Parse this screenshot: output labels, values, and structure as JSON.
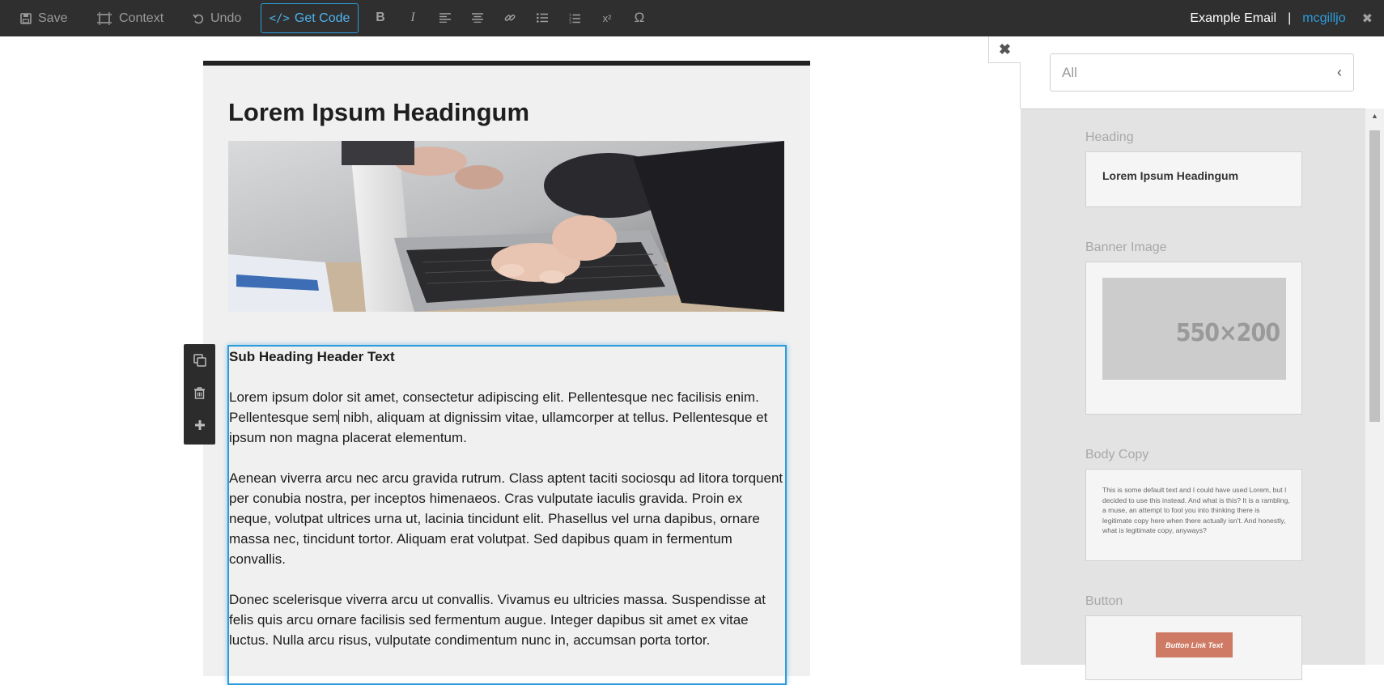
{
  "toolbar": {
    "save_label": "Save",
    "context_label": "Context",
    "undo_label": "Undo",
    "get_code_label": "Get Code",
    "get_code_icon": "</>",
    "format_buttons": [
      {
        "name": "bold",
        "glyph": "B"
      },
      {
        "name": "italic",
        "glyph": "I"
      },
      {
        "name": "align-left",
        "glyph": "align-left"
      },
      {
        "name": "align-center",
        "glyph": "align-center"
      },
      {
        "name": "link",
        "glyph": "link"
      },
      {
        "name": "bullet-list",
        "glyph": "bullet-list"
      },
      {
        "name": "numbered-list",
        "glyph": "numbered-list"
      },
      {
        "name": "superscript",
        "glyph": "x²"
      },
      {
        "name": "special-char",
        "glyph": "Ω"
      }
    ],
    "document_title": "Example Email",
    "separator": "|",
    "username": "mcgilljo",
    "close_glyph": "✖"
  },
  "email": {
    "heading": "Lorem Ipsum Headingum",
    "sub_heading": "Sub Heading Header Text",
    "paragraph_1_before_caret": "Lorem ipsum dolor sit amet, consectetur adipiscing elit. Pellentesque nec facilisis enim. Pellentesque sem",
    "paragraph_1_after_caret": "nibh, aliquam at dignissim vitae, ullamcorper at tellus. Pellentesque et ipsum non magna placerat elementum.",
    "paragraph_2": "Aenean viverra arcu nec arcu gravida rutrum. Class aptent taciti sociosqu ad litora torquent per conubia nostra, per inceptos himenaeos. Cras vulputate iaculis gravida. Proin ex neque, volutpat ultrices urna ut, lacinia tincidunt elit. Phasellus vel urna dapibus, ornare massa nec, tincidunt tortor. Aliquam erat volutpat. Sed dapibus quam in fermentum convallis.",
    "paragraph_3": "Donec scelerisque viverra arcu ut convallis. Vivamus eu ultricies massa. Suspendisse at felis quis arcu ornare facilisis sed fermentum augue. Integer dapibus sit amet ex vitae luctus. Nulla arcu risus, vulputate condimentum nunc in, accumsan porta tortor."
  },
  "block_tools": [
    "copy-icon",
    "trash-icon",
    "plus-icon"
  ],
  "panel": {
    "close_glyph": "✖",
    "filter_value": "All",
    "filter_chevron": "‹",
    "categories": {
      "heading": {
        "label": "Heading",
        "preview_text": "Lorem Ipsum Headingum"
      },
      "banner": {
        "label": "Banner Image",
        "placeholder_text": "550×200"
      },
      "body": {
        "label": "Body Copy",
        "preview_text": "This is some default text and I could have used Lorem, but I decided to use this instead. And what is this? It is a rambling, a muse, an attempt to fool you into thinking there is legitimate copy here when there actually isn't. And honestly, what is legitimate copy, anyways?"
      },
      "button": {
        "label": "Button",
        "preview_text": "Button Link Text"
      }
    }
  },
  "colors": {
    "toolbar_bg": "#2f2f2f",
    "accent_blue": "#2d9cdb",
    "panel_bg": "#e3e3e3",
    "button_preview": "#cf7a64"
  }
}
